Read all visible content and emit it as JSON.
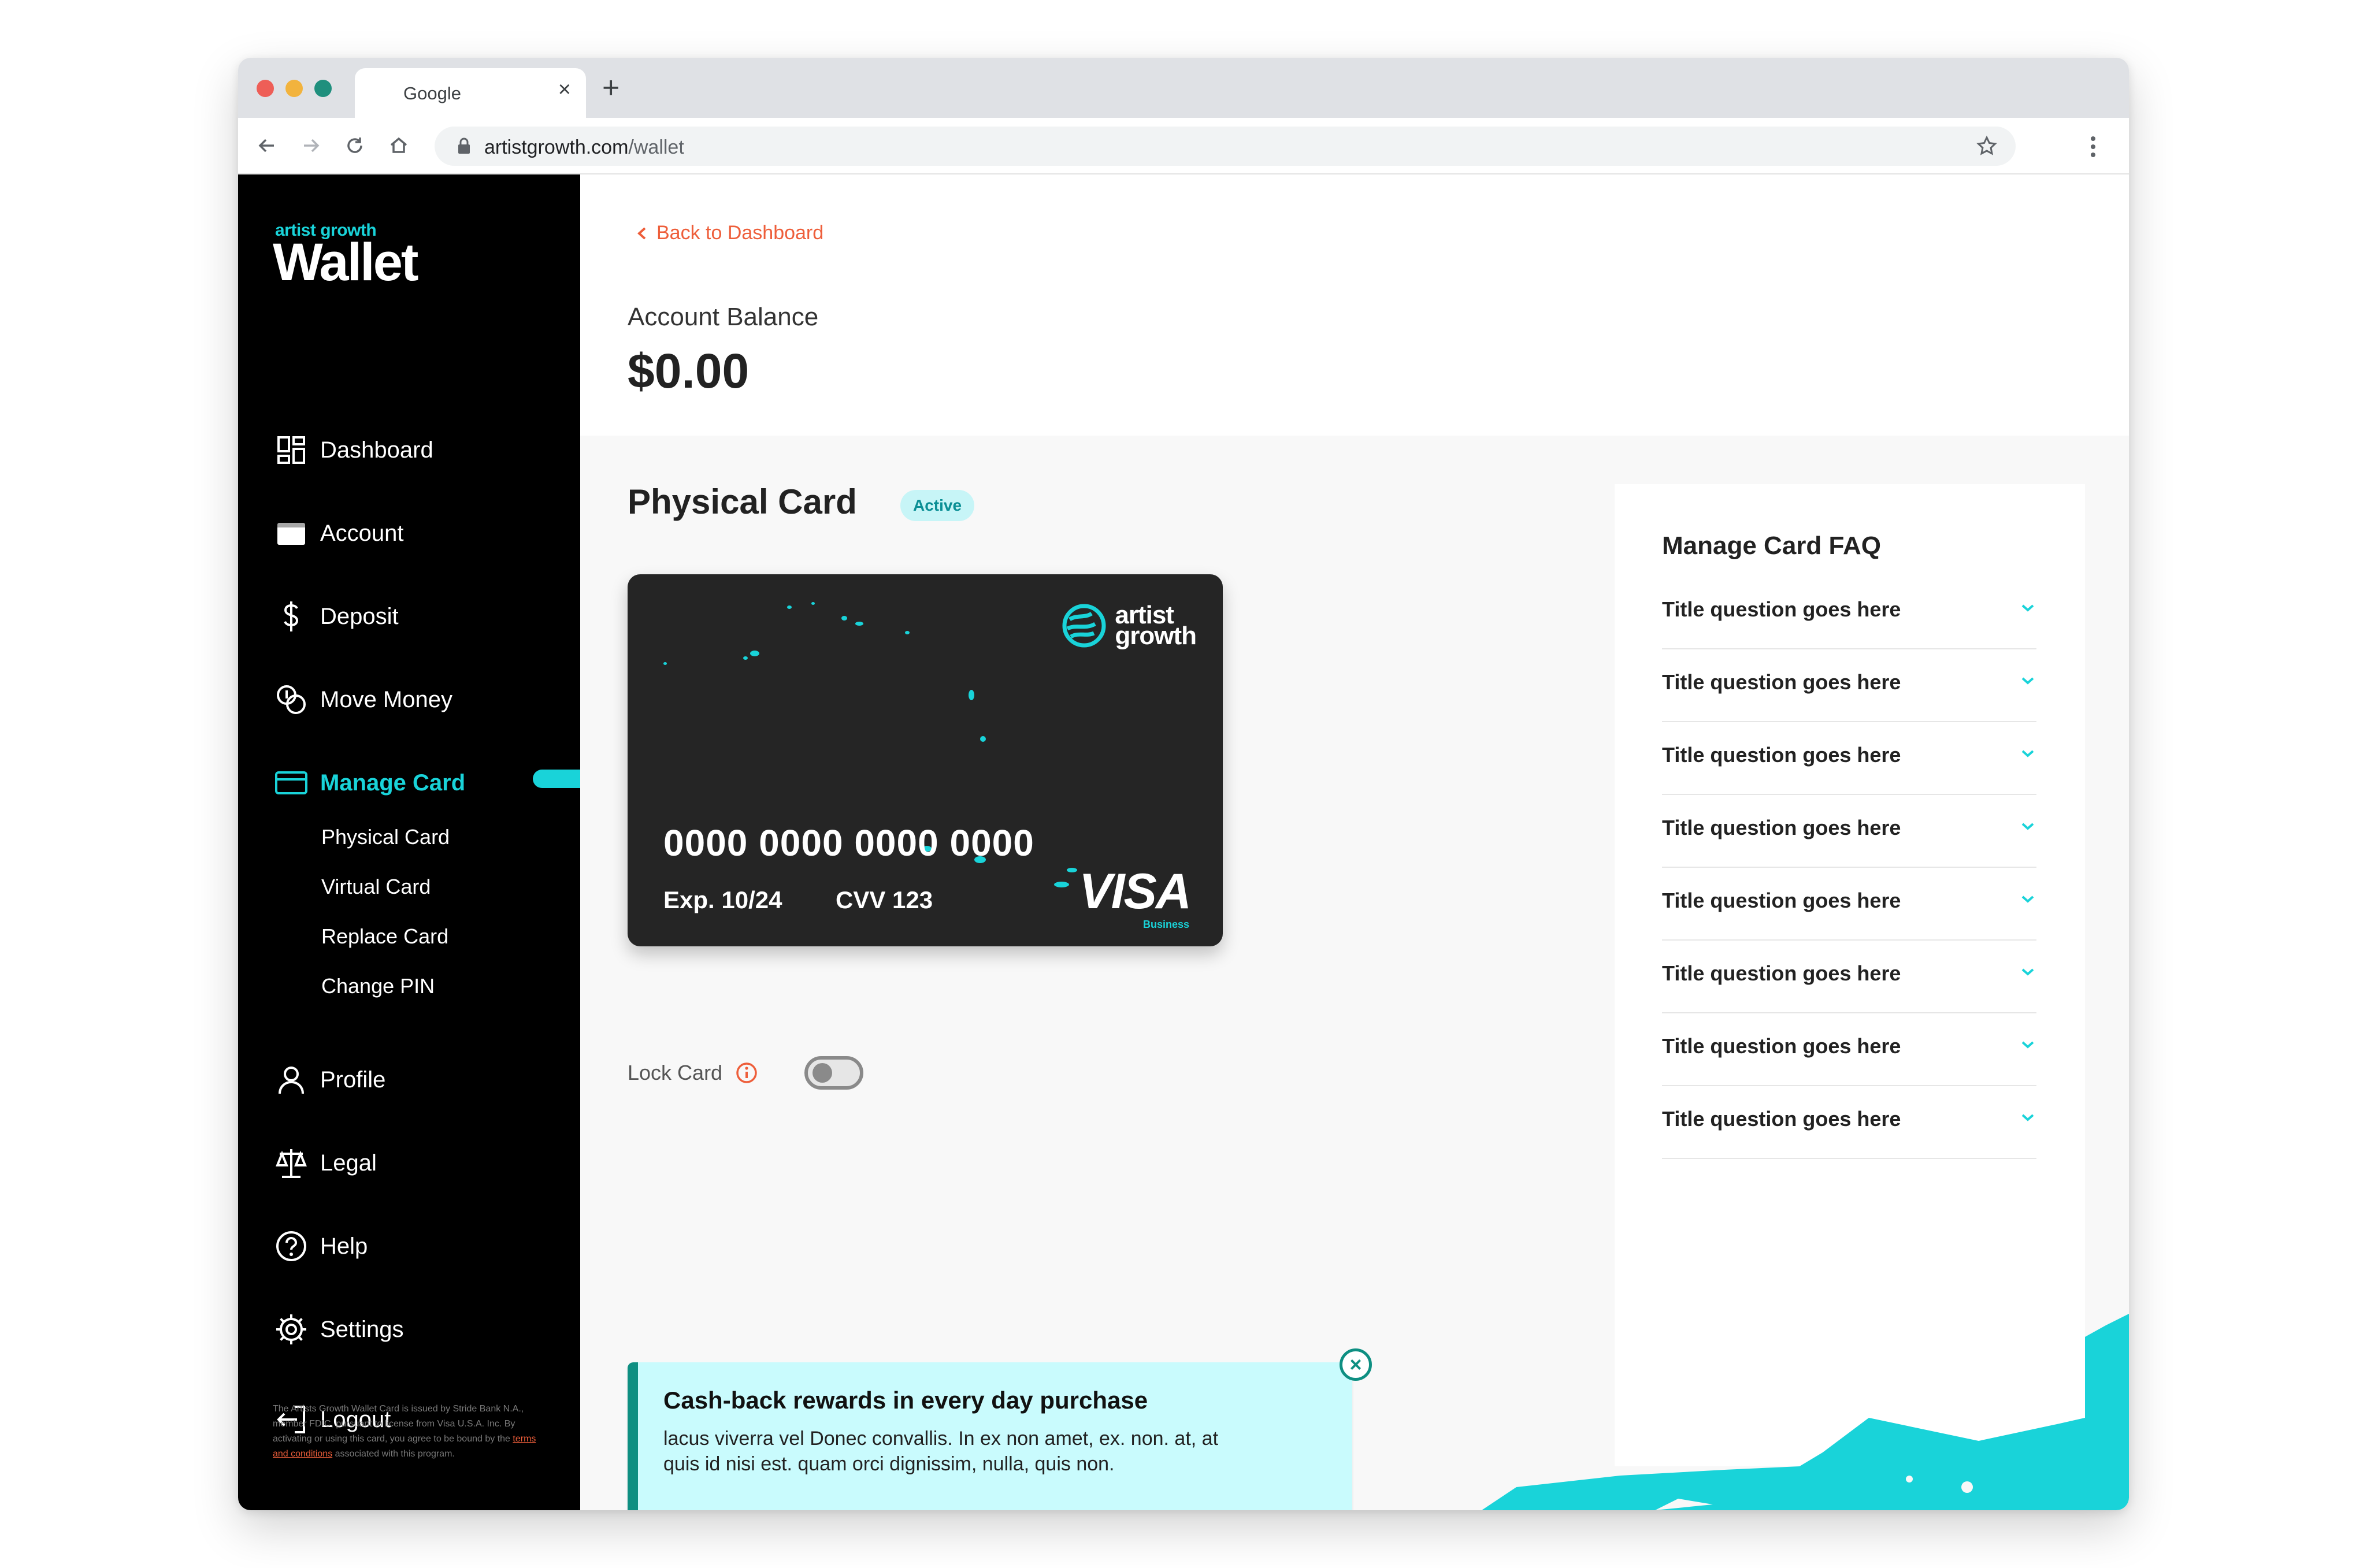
{
  "browser": {
    "tab_title": "Google",
    "url_host": "artistgrowth.com",
    "url_path": "/wallet"
  },
  "brand": {
    "small": "artist growth",
    "big": "Wallet"
  },
  "sidebar": {
    "items": [
      {
        "label": "Dashboard",
        "icon": "dashboard-icon"
      },
      {
        "label": "Account",
        "icon": "wallet-icon"
      },
      {
        "label": "Deposit",
        "icon": "dollar-icon"
      },
      {
        "label": "Move Money",
        "icon": "coins-icon"
      },
      {
        "label": "Manage Card",
        "icon": "card-icon"
      },
      {
        "label": "Profile",
        "icon": "user-icon"
      },
      {
        "label": "Legal",
        "icon": "scale-icon"
      },
      {
        "label": "Help",
        "icon": "help-icon"
      },
      {
        "label": "Settings",
        "icon": "gear-icon"
      },
      {
        "label": "Logout",
        "icon": "logout-icon"
      }
    ],
    "sub_items": [
      "Physical Card",
      "Virtual Card",
      "Replace Card",
      "Change PIN"
    ],
    "legal_text": "The Artists Growth Wallet Card is issued by Stride Bank N.A., member FDIC, pursuant to license from Visa U.S.A. Inc. By activating or using this card, you agree to be bound by the",
    "legal_link": "terms and conditions",
    "legal_tail": "associated with this program."
  },
  "header": {
    "back_label": "Back to Dashboard",
    "balance_label": "Account Balance",
    "balance_value": "$0.00"
  },
  "card_section": {
    "title": "Physical Card",
    "status": "Active",
    "card": {
      "logo_line1": "artist",
      "logo_line2": "growth",
      "number": "0000 0000 0000 0000",
      "exp": "Exp. 10/24",
      "cvv": "CVV 123",
      "network": "VISA",
      "network_sub": "Business"
    },
    "lock_label": "Lock Card",
    "lock_on": false
  },
  "promo": {
    "title": "Cash-back rewards in every day purchase",
    "body": "lacus viverra vel Donec convallis. In ex non amet, ex. non. at, at quis id nisi est. quam orci dignissim, nulla, quis non."
  },
  "faq": {
    "title": "Manage Card FAQ",
    "questions": [
      "Title question goes here",
      "Title question goes here",
      "Title question goes here",
      "Title question goes here",
      "Title question goes here",
      "Title question goes here",
      "Title question goes here",
      "Title question goes here"
    ]
  },
  "colors": {
    "accent": "#19d3d9",
    "link": "#ee5e3a",
    "sidebar_bg": "#000000",
    "promo_bg": "#c9fbfd",
    "promo_border": "#0e8f82"
  }
}
